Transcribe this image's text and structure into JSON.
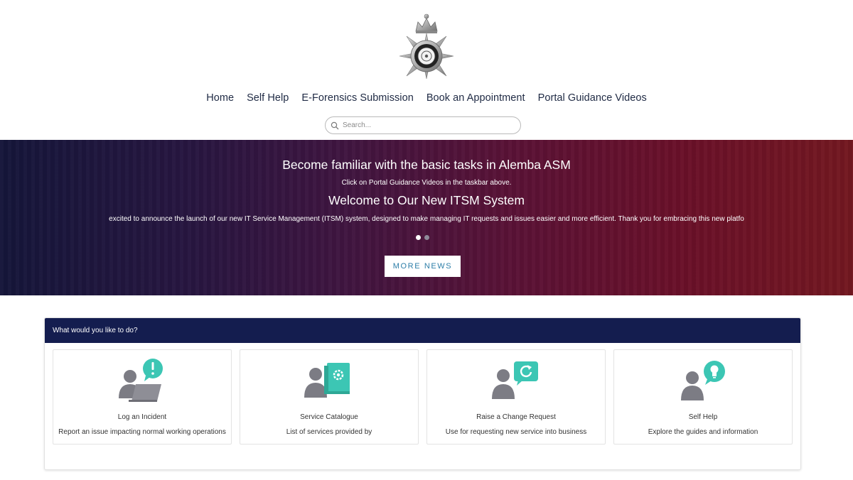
{
  "nav": {
    "items": [
      "Home",
      "Self Help",
      "E-Forensics Submission",
      "Book an Appointment",
      "Portal Guidance Videos"
    ]
  },
  "search": {
    "placeholder": "Search..."
  },
  "hero": {
    "heading1": "Become familiar with the basic tasks in Alemba ASM",
    "subtext1": "Click on Portal Guidance Videos in the taskbar above.",
    "heading2": "Welcome to Our New ITSM System",
    "subtext2": "excited to announce the launch of our new IT Service Management (ITSM) system, designed to make managing IT requests and issues easier and more efficient. Thank you for embracing this new platfo",
    "slides_total": 2,
    "active_slide": 1,
    "button_label": "MORE NEWS"
  },
  "actions": {
    "header": "What would you like to do?",
    "cards": [
      {
        "title": "Log an Incident",
        "description": "Report an issue impacting normal working operations",
        "icon": "incident-icon"
      },
      {
        "title": "Service Catalogue",
        "description": "List of services provided by",
        "icon": "service-catalogue-icon"
      },
      {
        "title": "Raise a Change Request",
        "description": "Use for requesting new service into business",
        "icon": "change-request-icon"
      },
      {
        "title": "Self Help",
        "description": "Explore the guides and information",
        "icon": "self-help-icon"
      }
    ]
  },
  "colors": {
    "accent_teal": "#3cc6b4",
    "header_navy": "#141d4f",
    "button_text": "#2d7ea8"
  }
}
